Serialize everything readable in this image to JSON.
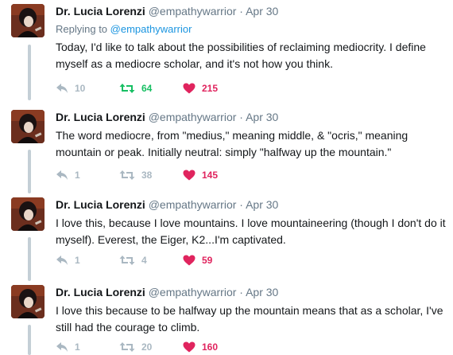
{
  "tweets": [
    {
      "name": "Dr. Lucia Lorenzi",
      "handle": "@empathywarrior",
      "separator": "·",
      "time": "Apr 30",
      "replying_prefix": "Replying to",
      "replying_to": "@empathywarrior",
      "text": "Today, I'd like to talk about the possibilities of reclaiming mediocrity. I define myself as a mediocre scholar, and it's not how you think.",
      "replies": "10",
      "retweets": "64",
      "likes": "215"
    },
    {
      "name": "Dr. Lucia Lorenzi",
      "handle": "@empathywarrior",
      "separator": "·",
      "time": "Apr 30",
      "text": "The word mediocre, from \"medius,\" meaning middle, & \"ocris,\" meaning mountain or peak. Initially neutral: simply \"halfway up the mountain.\"",
      "replies": "1",
      "retweets": "38",
      "likes": "145"
    },
    {
      "name": "Dr. Lucia Lorenzi",
      "handle": "@empathywarrior",
      "separator": "·",
      "time": "Apr 30",
      "text": "I love this, because I love mountains. I love mountaineering (though I don't do it myself). Everest, the Eiger, K2...I'm captivated.",
      "replies": "1",
      "retweets": "4",
      "likes": "59"
    },
    {
      "name": "Dr. Lucia Lorenzi",
      "handle": "@empathywarrior",
      "separator": "·",
      "time": "Apr 30",
      "text": "I love this because to be halfway up the mountain means that as a scholar, I've still had the courage to climb.",
      "replies": "1",
      "retweets": "20",
      "likes": "160"
    }
  ],
  "colors": {
    "thread_line": "#c4cfd6",
    "retweet_active": "#17bf63",
    "like": "#e0245e",
    "muted": "#657786",
    "link": "#1b95e0"
  },
  "icons": [
    "reply-icon",
    "retweet-icon",
    "heart-icon"
  ]
}
